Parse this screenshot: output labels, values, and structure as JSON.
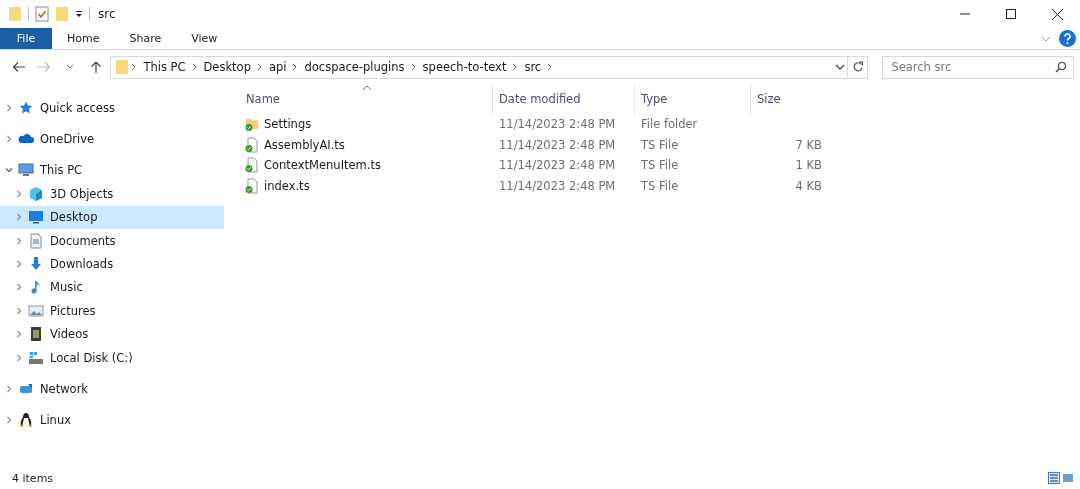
{
  "window": {
    "title": "src"
  },
  "ribbon": {
    "tabs": [
      {
        "label": "File",
        "kind": "file"
      },
      {
        "label": "Home",
        "kind": "tab"
      },
      {
        "label": "Share",
        "kind": "tab"
      },
      {
        "label": "View",
        "kind": "tab"
      }
    ]
  },
  "address": {
    "path": [
      "This PC",
      "Desktop",
      "api",
      "docspace-plugins",
      "speech-to-text",
      "src"
    ],
    "search_placeholder": "Search src"
  },
  "sidebar": {
    "items": [
      {
        "label": "Quick access",
        "kind": "star",
        "expanded": false,
        "selected": false
      },
      {
        "label": "OneDrive",
        "kind": "cloud",
        "expanded": false,
        "selected": false
      },
      {
        "label": "This PC",
        "kind": "pc",
        "expanded": true,
        "selected": false,
        "children": [
          {
            "label": "3D Objects",
            "kind": "cube",
            "expanded": false,
            "selected": false
          },
          {
            "label": "Desktop",
            "kind": "desktop",
            "expanded": false,
            "selected": true
          },
          {
            "label": "Documents",
            "kind": "doc",
            "expanded": false,
            "selected": false
          },
          {
            "label": "Downloads",
            "kind": "download",
            "expanded": false,
            "selected": false
          },
          {
            "label": "Music",
            "kind": "music",
            "expanded": false,
            "selected": false
          },
          {
            "label": "Pictures",
            "kind": "pictures",
            "expanded": false,
            "selected": false
          },
          {
            "label": "Videos",
            "kind": "videos",
            "expanded": false,
            "selected": false
          },
          {
            "label": "Local Disk (C:)",
            "kind": "disk",
            "expanded": false,
            "selected": false
          }
        ]
      },
      {
        "label": "Network",
        "kind": "network",
        "expanded": false,
        "selected": false
      },
      {
        "label": "Linux",
        "kind": "linux",
        "expanded": false,
        "selected": false
      }
    ]
  },
  "table": {
    "columns": [
      {
        "label": "Name",
        "sorted": true
      },
      {
        "label": "Date modified",
        "sorted": false
      },
      {
        "label": "Type",
        "sorted": false
      },
      {
        "label": "Size",
        "sorted": false
      }
    ],
    "rows": [
      {
        "kind": "folder",
        "name": "Settings",
        "date": "11/14/2023 2:48 PM",
        "type": "File folder"
      },
      {
        "kind": "file",
        "name": "AssemblyAI.ts",
        "date": "11/14/2023 2:48 PM",
        "type": "TS File",
        "size": "7 KB"
      },
      {
        "kind": "file",
        "name": "ContextMenuItem.ts",
        "date": "11/14/2023 2:48 PM",
        "type": "TS File",
        "size": "1 KB"
      },
      {
        "kind": "file",
        "name": "index.ts",
        "date": "11/14/2023 2:48 PM",
        "type": "TS File",
        "size": "4 KB"
      }
    ]
  },
  "status_bar": {
    "text": "4 items"
  }
}
